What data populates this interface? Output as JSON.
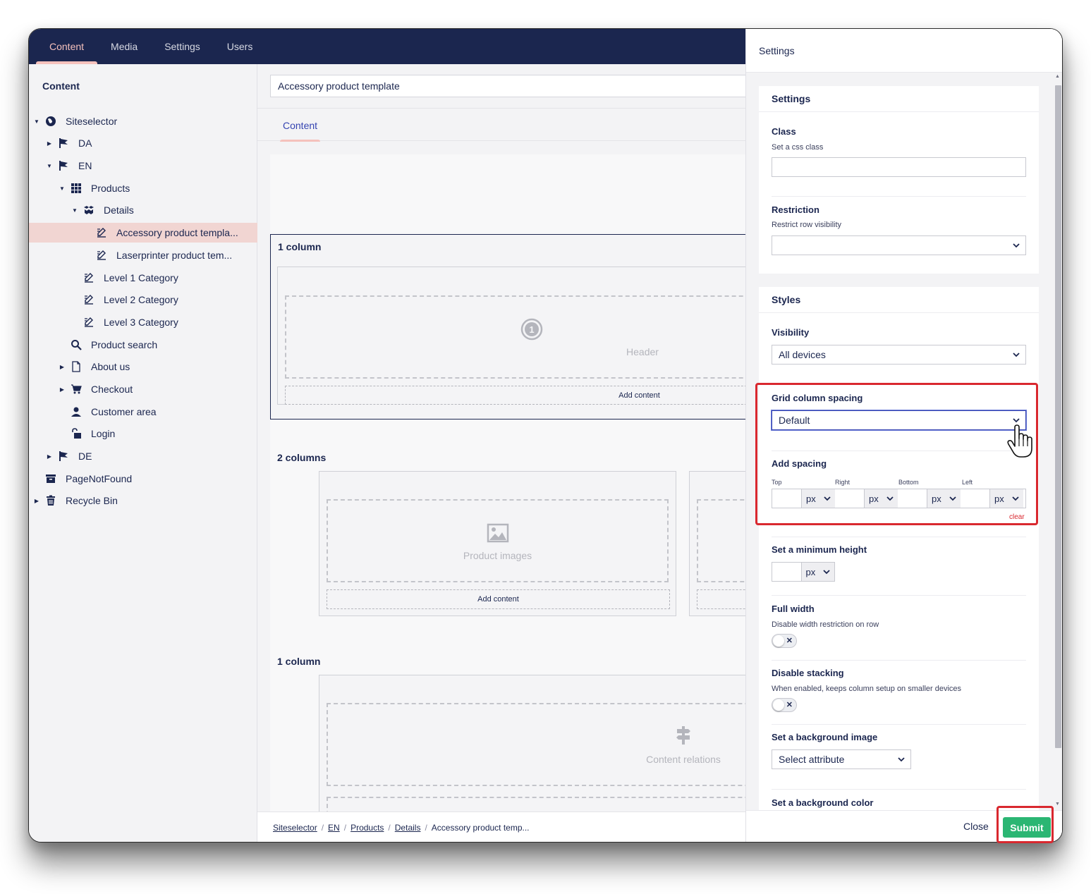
{
  "nav": {
    "tabs": [
      {
        "label": "Content",
        "active": true
      },
      {
        "label": "Media",
        "active": false
      },
      {
        "label": "Settings",
        "active": false
      },
      {
        "label": "Users",
        "active": false
      }
    ]
  },
  "tree": {
    "title": "Content",
    "items": [
      {
        "label": "Siteselector",
        "icon": "globe-icon",
        "caret": "down"
      },
      {
        "label": "DA",
        "icon": "flag-icon",
        "caret": "right"
      },
      {
        "label": "EN",
        "icon": "flag-icon",
        "caret": "down"
      },
      {
        "label": "Products",
        "icon": "grid-icon",
        "caret": "down"
      },
      {
        "label": "Details",
        "icon": "boxes-icon",
        "caret": "down"
      },
      {
        "label": "Accessory product templa...",
        "icon": "edit-icon",
        "caret": "",
        "active": true
      },
      {
        "label": "Laserprinter product tem...",
        "icon": "edit-icon",
        "caret": ""
      },
      {
        "label": "Level 1 Category",
        "icon": "edit-icon",
        "caret": ""
      },
      {
        "label": "Level 2 Category",
        "icon": "edit-icon",
        "caret": ""
      },
      {
        "label": "Level 3 Category",
        "icon": "edit-icon",
        "caret": ""
      },
      {
        "label": "Product search",
        "icon": "search-icon",
        "caret": ""
      },
      {
        "label": "About us",
        "icon": "document-icon",
        "caret": "right"
      },
      {
        "label": "Checkout",
        "icon": "cart-icon",
        "caret": "right"
      },
      {
        "label": "Customer area",
        "icon": "user-icon",
        "caret": ""
      },
      {
        "label": "Login",
        "icon": "unlock-icon",
        "caret": ""
      },
      {
        "label": "DE",
        "icon": "flag-icon",
        "caret": "right"
      },
      {
        "label": "PageNotFound",
        "icon": "archive-icon",
        "caret": ""
      },
      {
        "label": "Recycle Bin",
        "icon": "trash-icon",
        "caret": "right"
      }
    ]
  },
  "editor": {
    "name": "Accessory product template",
    "tab": "Content",
    "rows": [
      {
        "label": "1 column",
        "placeholder": "Header",
        "add": "Add content"
      },
      {
        "label": "2 columns",
        "placeholder": "Product images",
        "add": "Add content"
      },
      {
        "label": "1 column",
        "placeholder": "Content relations"
      }
    ]
  },
  "breadcrumb": {
    "items": [
      "Siteselector",
      "EN",
      "Products",
      "Details"
    ],
    "current": "Accessory product temp..."
  },
  "panel": {
    "title": "Settings",
    "settings_box": {
      "heading": "Settings",
      "class_label": "Class",
      "class_desc": "Set a css class",
      "class_value": "",
      "restriction_label": "Restriction",
      "restriction_desc": "Restrict row visibility",
      "restriction_value": ""
    },
    "styles_box": {
      "heading": "Styles",
      "visibility_label": "Visibility",
      "visibility_value": "All devices",
      "spacing_label": "Grid column spacing",
      "spacing_value": "Default",
      "add_spacing_label": "Add spacing",
      "spacing_sides": [
        "Top",
        "Right",
        "Bottom",
        "Left"
      ],
      "unit": "px",
      "clear_label": "clear",
      "min_height_label": "Set a minimum height",
      "full_width_label": "Full width",
      "full_width_desc": "Disable width restriction on row",
      "disable_stacking_label": "Disable stacking",
      "disable_stacking_desc": "When enabled, keeps column setup on smaller devices",
      "bg_image_label": "Set a background image",
      "bg_image_value": "Select attribute",
      "bg_color_label": "Set a background color"
    },
    "footer": {
      "close_label": "Close",
      "submit_label": "Submit"
    }
  },
  "colors": {
    "nav_bg": "#1b264f",
    "accent": "#f5c1bc",
    "submit": "#2bb673",
    "highlight": "#d9282f"
  }
}
